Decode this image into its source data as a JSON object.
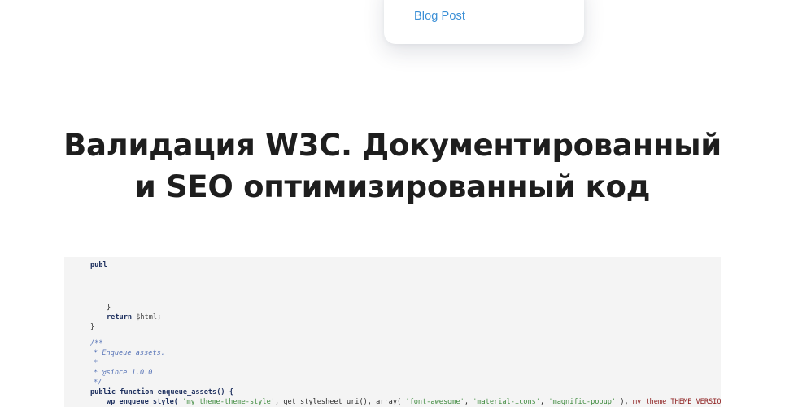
{
  "dropdown": {
    "link_label": "Blog Post"
  },
  "heading": {
    "line1": "Валидация W3C. Документированный",
    "line2": "и SEO оптимизированный код"
  },
  "code": {
    "line1": "publ",
    "line2": "}",
    "line3_kw": "return",
    "line3_var": "$html;",
    "line4": "}",
    "line5": "/**",
    "line6": "* Enqueue assets.",
    "line7": "*",
    "line8_tag": "* @since",
    "line8_ver": "1.0.0",
    "line9": "*/",
    "line10_kw": "public function",
    "line10_fn": "enqueue_assets() {",
    "line11_fn": "wp_enqueue_style(",
    "line11_s1": "'my_theme-theme-style'",
    "line11_mid": ", get_stylesheet_uri(), array(",
    "line11_s2": "'font-awesome'",
    "line11_s3": "'material-icons'",
    "line11_s4": "'magnific-popup'",
    "line11_tail": " ),",
    "line11_const": "my_theme_THEME_VERSION",
    "line11_end": " );"
  }
}
